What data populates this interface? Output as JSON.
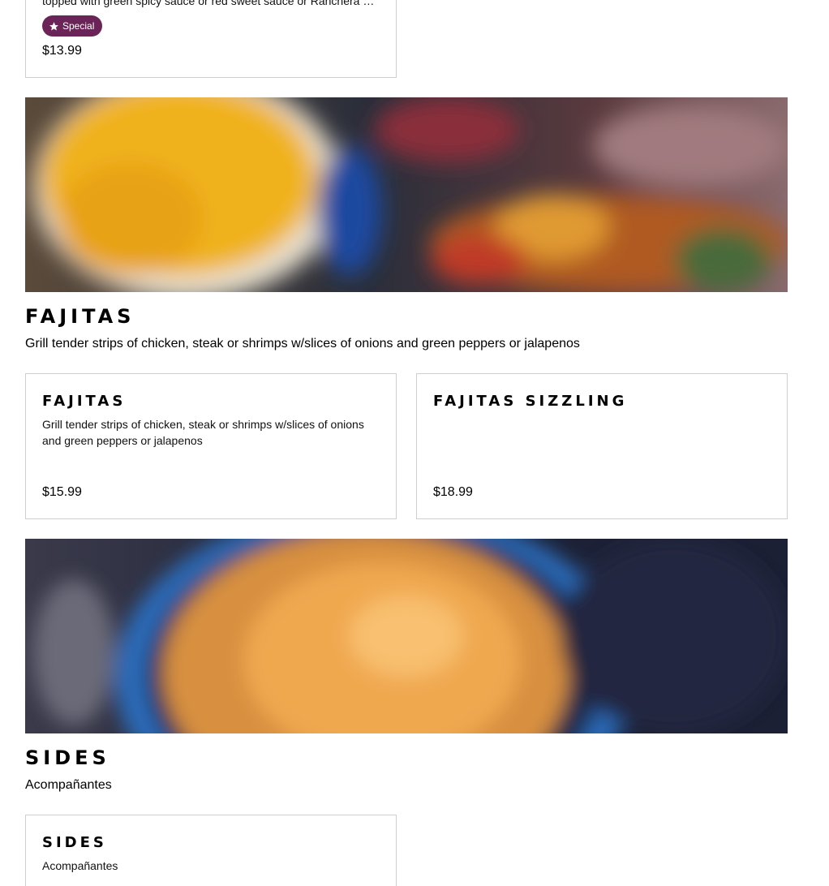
{
  "top_card": {
    "description": "topped with green spicy sauce or red sweet sauce or Ranchera sauce",
    "badge_label": "Special",
    "price": "$13.99"
  },
  "sections": [
    {
      "title": "FAJITAS",
      "description": "Grill tender strips of chicken, steak or shrimps w/slices of onions and green peppers or jalapenos",
      "banner_icon": "fajitas-food-photo",
      "items": [
        {
          "title": "FAJITAS",
          "description": "Grill tender strips of chicken, steak or shrimps w/slices of onions and green peppers or jalapenos",
          "price": "$15.99"
        },
        {
          "title": "FAJITAS SIZZLING",
          "description": "",
          "price": "$18.99"
        }
      ]
    },
    {
      "title": "SIDES",
      "description": "Acompañantes",
      "banner_icon": "sides-food-photo",
      "items": [
        {
          "title": "SIDES",
          "description": "Acompañantes"
        }
      ]
    }
  ],
  "colors": {
    "badge_background": "#6b2458",
    "card_border": "#cfcfcf"
  }
}
